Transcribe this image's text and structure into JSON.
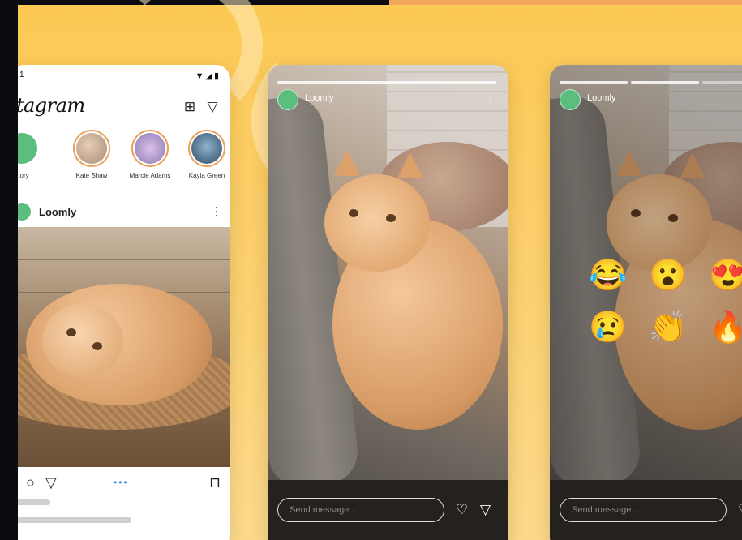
{
  "feed": {
    "status_left": "1",
    "status_icons": "▼◢▮",
    "logo_text": "stagram",
    "add_icon": "⊞",
    "send_icon": "▽",
    "stories": [
      {
        "name": "story",
        "color": "#5cbe7e"
      },
      {
        "name": "Kate Shaw",
        "color": "#c7a486"
      },
      {
        "name": "Marcie Adams",
        "color": "#a48fc4"
      },
      {
        "name": "Kayla Green",
        "color": "#3b5d7a"
      }
    ],
    "post": {
      "account": "Loomly",
      "menu": "⋮",
      "actions_dots": "•••"
    }
  },
  "story_view": {
    "account": "Loomly",
    "menu": "⋮",
    "reply_placeholder": "Send message...",
    "heart_icon": "♡",
    "send_icon": "▽"
  },
  "reactions": [
    "😂",
    "😮",
    "😍",
    "😢",
    "👏",
    "🔥"
  ],
  "colors": {
    "background": "#fbc953",
    "brand_green": "#5cbe7e",
    "story_ring": "#e8a35a",
    "reply_bar": "#24211f"
  }
}
